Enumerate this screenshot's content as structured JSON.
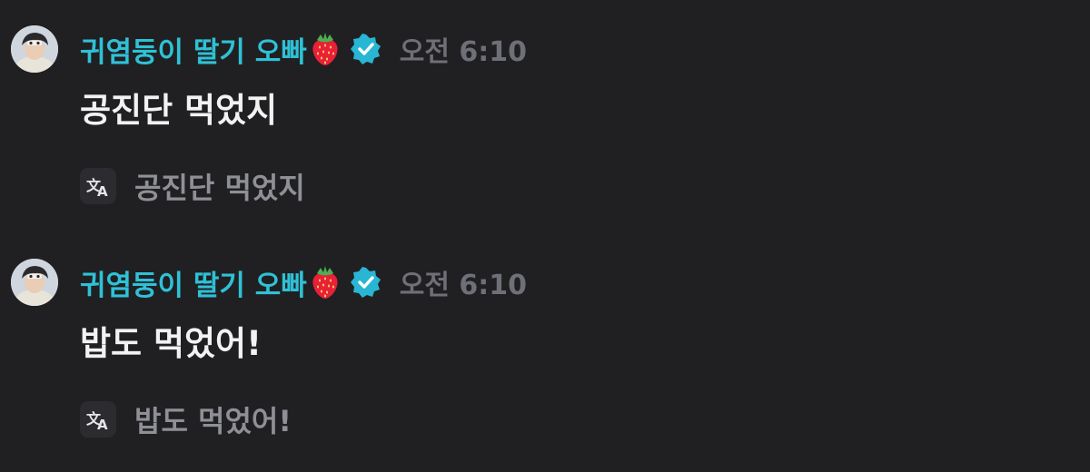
{
  "messages": [
    {
      "author": "귀염둥이 딸기 오빠",
      "author_emoji": "strawberry-icon",
      "verified": true,
      "timestamp": "오전 6:10",
      "text": "공진단 먹었지",
      "translation": "공진단 먹었지"
    },
    {
      "author": "귀염둥이 딸기 오빠",
      "author_emoji": "strawberry-icon",
      "verified": true,
      "timestamp": "오전 6:10",
      "text": "밥도 먹었어!",
      "translation": "밥도 먹었어!"
    }
  ],
  "colors": {
    "background": "#202022",
    "author_name": "#2fc1d6",
    "timestamp": "#6f7077",
    "message_text": "#f2f2f3",
    "translation_text": "#8f9096",
    "verified_badge": "#29b6d4"
  }
}
